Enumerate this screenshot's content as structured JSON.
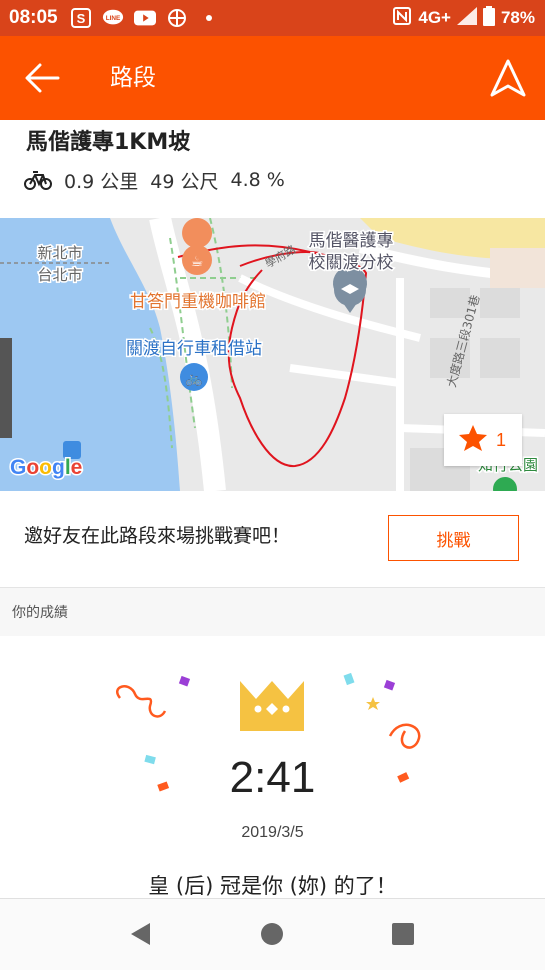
{
  "status_bar": {
    "time": "08:05",
    "network": "4G+",
    "battery": "78%",
    "left_icons": [
      "s-app-icon",
      "line-icon",
      "youtube-icon",
      "compass-icon",
      "dot-icon"
    ],
    "right_icons": [
      "nfc-icon",
      "signal-icon",
      "battery-icon"
    ]
  },
  "app_bar": {
    "title": "路段",
    "back_icon": "arrow-left-icon",
    "nav_icon": "navigation-arrow-icon"
  },
  "segment": {
    "name": "馬偕護專1KM坡",
    "distance": "0.9 公里",
    "elevation": "49 公尺",
    "grade": "4.8 %"
  },
  "map": {
    "labels": {
      "district": "新北市\n台北市",
      "cafe": "甘答門重機咖啡館",
      "bike_rental": "關渡自行車租借站",
      "school": "馬偕醫護專\n校關渡分校",
      "road_vertical": "大度路三段301巷",
      "road_small": "學府路",
      "park": "知行公園",
      "logo": "Google"
    },
    "star_count": "1"
  },
  "challenge": {
    "text": "邀好友在此路段來場挑戰賽吧！",
    "button_label": "挑戰"
  },
  "results": {
    "section_label": "你的成績",
    "time": "2:41",
    "date": "2019/3/5",
    "kom_text": "皇 (后) 冠是你 (妳) 的了！"
  },
  "nav_bar": {
    "buttons": [
      "back-triangle-icon",
      "home-circle-icon",
      "recents-square-icon"
    ]
  },
  "colors": {
    "status_bar": "#d9441a",
    "brand": "#fc5200",
    "route": "#e0141e",
    "water": "#9dc8f2",
    "crown": "#f5c242"
  }
}
